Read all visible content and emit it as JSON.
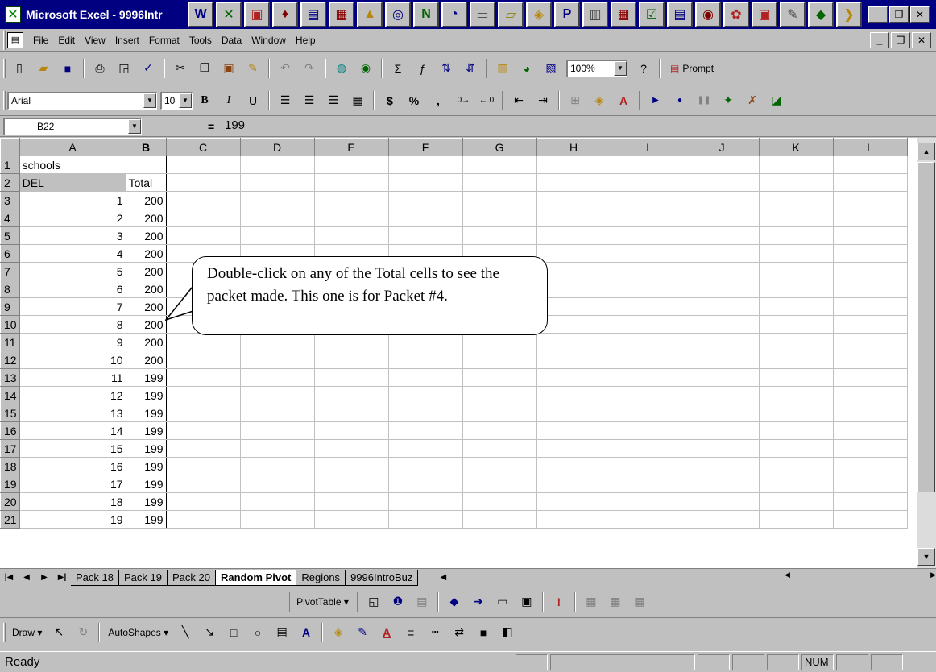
{
  "window": {
    "title": "Microsoft Excel - 9996Intr"
  },
  "menu": {
    "items": [
      "File",
      "Edit",
      "View",
      "Insert",
      "Format",
      "Tools",
      "Data",
      "Window",
      "Help"
    ]
  },
  "toolbar": {
    "zoom": "100%",
    "prompt_label": "Prompt"
  },
  "format_toolbar": {
    "font": "Arial",
    "size": "10"
  },
  "formula_bar": {
    "cell_ref": "B22",
    "equals": "=",
    "value": "199"
  },
  "columns": [
    "A",
    "B",
    "C",
    "D",
    "E",
    "F",
    "G",
    "H",
    "I",
    "J",
    "K",
    "L"
  ],
  "rows": [
    {
      "n": "1",
      "a": "schools",
      "b": ""
    },
    {
      "n": "2",
      "a": "DEL",
      "b": "Total"
    },
    {
      "n": "3",
      "a": "1",
      "b": "200"
    },
    {
      "n": "4",
      "a": "2",
      "b": "200"
    },
    {
      "n": "5",
      "a": "3",
      "b": "200"
    },
    {
      "n": "6",
      "a": "4",
      "b": "200"
    },
    {
      "n": "7",
      "a": "5",
      "b": "200"
    },
    {
      "n": "8",
      "a": "6",
      "b": "200"
    },
    {
      "n": "9",
      "a": "7",
      "b": "200"
    },
    {
      "n": "10",
      "a": "8",
      "b": "200"
    },
    {
      "n": "11",
      "a": "9",
      "b": "200"
    },
    {
      "n": "12",
      "a": "10",
      "b": "200"
    },
    {
      "n": "13",
      "a": "11",
      "b": "199"
    },
    {
      "n": "14",
      "a": "12",
      "b": "199"
    },
    {
      "n": "15",
      "a": "13",
      "b": "199"
    },
    {
      "n": "16",
      "a": "14",
      "b": "199"
    },
    {
      "n": "17",
      "a": "15",
      "b": "199"
    },
    {
      "n": "18",
      "a": "16",
      "b": "199"
    },
    {
      "n": "19",
      "a": "17",
      "b": "199"
    },
    {
      "n": "20",
      "a": "18",
      "b": "199"
    },
    {
      "n": "21",
      "a": "19",
      "b": "199"
    }
  ],
  "callout": {
    "text": "Double-click on any of the Total cells to see the packet made.  This one is for Packet #4."
  },
  "sheet_tabs": [
    "Pack 18",
    "Pack 19",
    "Pack 20",
    "Random Pivot",
    "Regions",
    "9996IntroBuz"
  ],
  "active_tab": "Random Pivot",
  "pivot_toolbar": {
    "pivot_label": "PivotTable ▾"
  },
  "draw_toolbar": {
    "draw_label": "Draw ▾",
    "autoshapes_label": "AutoShapes ▾"
  },
  "status": {
    "text": "Ready",
    "num": "NUM"
  }
}
